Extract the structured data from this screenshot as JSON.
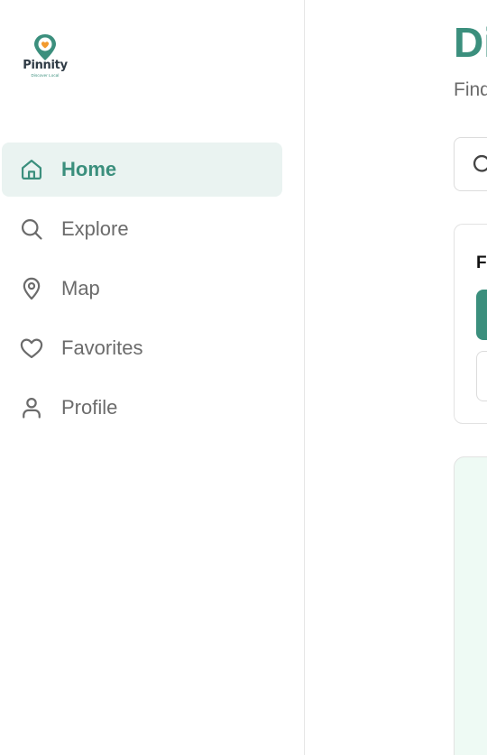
{
  "brand": {
    "name": "Pinnity",
    "tagline": "Discover Local",
    "accent_color": "#3b8f7d",
    "heart_color": "#f29a2e"
  },
  "sidebar": {
    "items": [
      {
        "label": "Home",
        "icon": "home-icon",
        "active": true
      },
      {
        "label": "Explore",
        "icon": "search-icon",
        "active": false
      },
      {
        "label": "Map",
        "icon": "map-pin-icon",
        "active": false
      },
      {
        "label": "Favorites",
        "icon": "heart-icon",
        "active": false
      },
      {
        "label": "Profile",
        "icon": "user-icon",
        "active": false
      }
    ]
  },
  "main": {
    "title": "Di",
    "subtitle": "Find",
    "search": {
      "icon": "search-icon"
    },
    "filter": {
      "label": "Fi"
    }
  }
}
